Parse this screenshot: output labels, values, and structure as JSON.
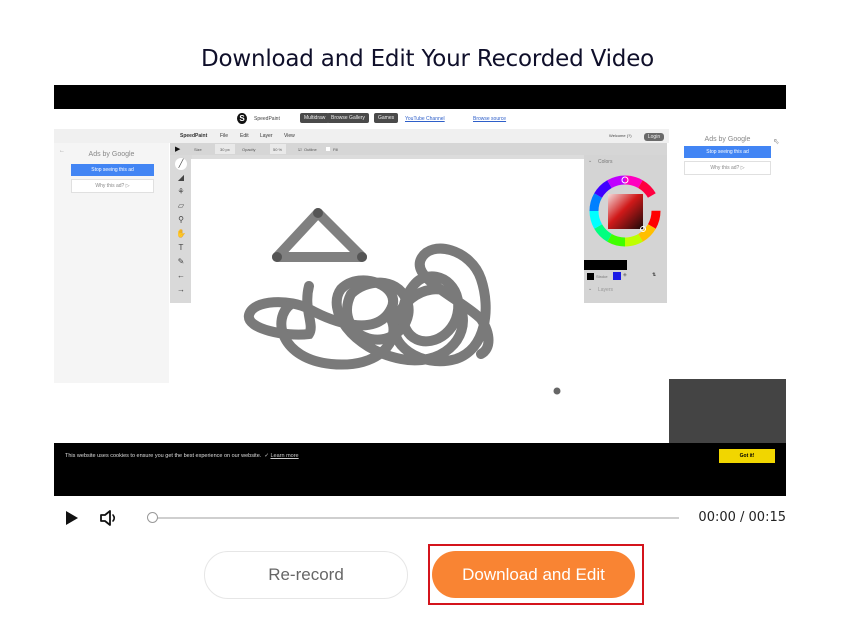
{
  "page": {
    "title": "Download and Edit Your Recorded Video"
  },
  "recorded_app": {
    "brand": "SpeedPaint",
    "nav_buttons": [
      "Multidraw",
      "Browse Gallery",
      "Games"
    ],
    "nav_links": [
      "YouTube Channel",
      "Browse source"
    ],
    "menu": [
      "SpeedPaint",
      "File",
      "Edit",
      "Layer",
      "View"
    ],
    "welcome_text": "Welcome (?)",
    "login_label": "Login",
    "tool_options": {
      "size_label": "Size",
      "size_value": "30 px",
      "opacity_label": "Opacity",
      "opacity_value": "50 %",
      "outline_label": "Outline",
      "fill_label": "Fill"
    },
    "tools": [
      "brush-icon",
      "bucket-icon",
      "stamp-icon",
      "eraser-icon",
      "zoom-icon",
      "hand-icon",
      "text-icon",
      "eyedropper-icon",
      "undo-arrow-icon",
      "redo-arrow-icon"
    ],
    "color_panel": {
      "header": "Colors",
      "stroke_label": "Stroke",
      "layers_label": "Layers",
      "primary_color": "#000000",
      "secondary_color": "#1a1ae6"
    },
    "ads": {
      "header": "Ads by Google",
      "stop_label": "Stop seeing this ad",
      "why_label": "Why this ad? ▷"
    },
    "cookie_banner": {
      "text": "This website uses cookies to ensure you get the best experience on our website.",
      "link": "Learn more",
      "button": "Got it!"
    }
  },
  "player": {
    "current_time": "00:00",
    "duration": "00:15",
    "time_display": "00:00 / 00:15",
    "progress": 0
  },
  "actions": {
    "rerecord_label": "Re-record",
    "download_label": "Download and Edit"
  },
  "colors": {
    "accent_orange": "#f98433",
    "highlight_red": "#d4141c",
    "cookie_button": "#f1d600",
    "ad_blue": "#4285f4"
  }
}
